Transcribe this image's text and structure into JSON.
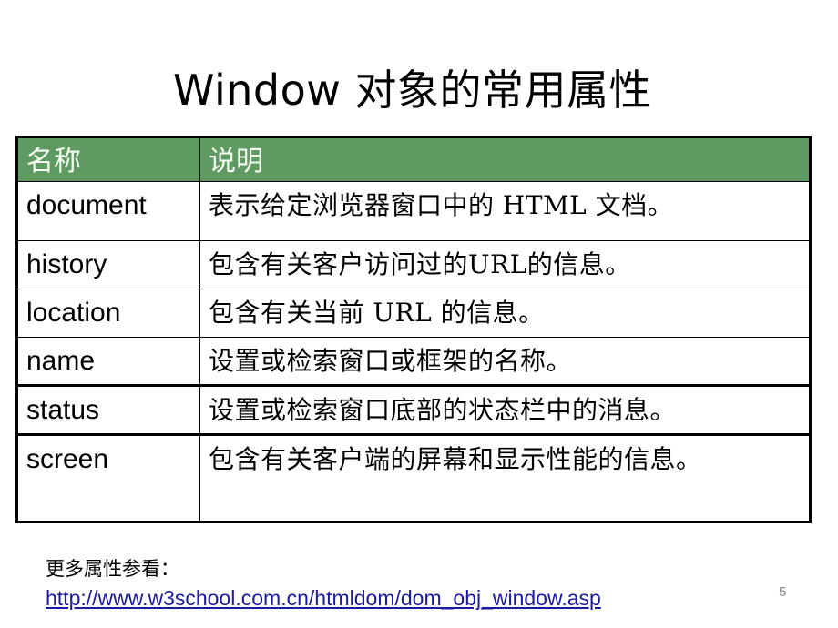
{
  "slide": {
    "title": "Window 对象的常用属性",
    "page_number": "5",
    "colors": {
      "header_bg": "#5f9a62",
      "header_text": "#f4fff2",
      "link": "#1a1aa6"
    }
  },
  "table": {
    "headers": [
      "名称",
      "说明"
    ],
    "rows": [
      {
        "name": "document",
        "desc": "表示给定浏览器窗口中的 HTML 文档。"
      },
      {
        "name": "history",
        "desc": "包含有关客户访问过的URL的信息。"
      },
      {
        "name": "location",
        "desc": "包含有关当前 URL 的信息。"
      },
      {
        "name": "name",
        "desc": "设置或检索窗口或框架的名称。"
      },
      {
        "name": "status",
        "desc": "设置或检索窗口底部的状态栏中的消息。"
      },
      {
        "name": "screen",
        "desc": "包含有关客户端的屏幕和显示性能的信息。"
      }
    ]
  },
  "footer": {
    "more_label": "更多属性参看：",
    "link_text": "http://www.w3school.com.cn/htmldom/dom_obj_window.asp"
  }
}
